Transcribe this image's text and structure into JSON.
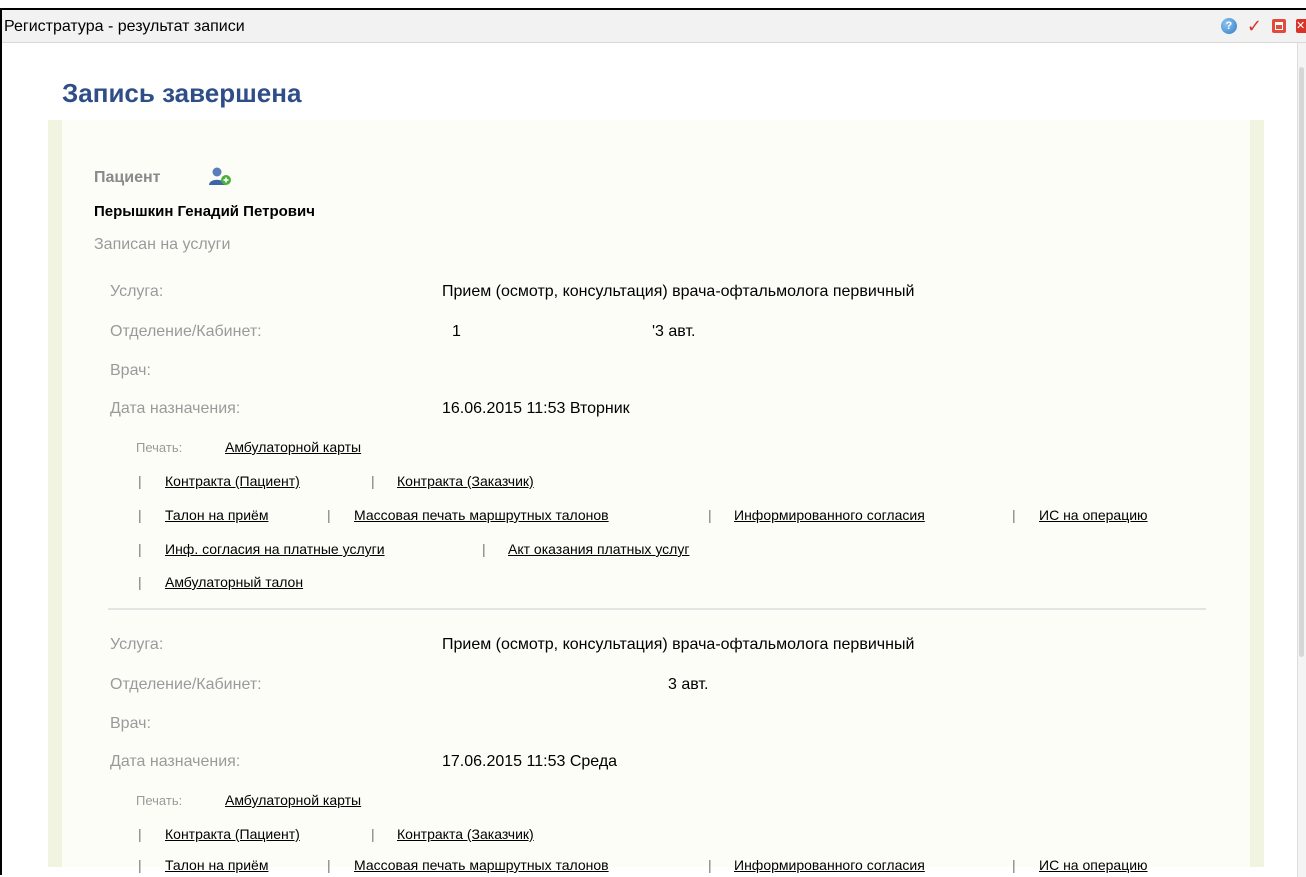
{
  "window": {
    "title": "Регистратура - результат записи",
    "help_glyph": "?",
    "check_glyph": "✓",
    "close_glyph": "✕",
    "icons": [
      "help-icon",
      "check-icon",
      "minimize-icon",
      "close-icon"
    ],
    "accent_color": "#2f4e88"
  },
  "page": {
    "heading": "Запись завершена"
  },
  "patient": {
    "label": "Пациент",
    "name": "Перышкин Генадий Петрович",
    "enrolled_label": "Записан на услуги"
  },
  "labels": {
    "service": "Услуга:",
    "department": "Отделение/Кабинет:",
    "doctor": "Врач:",
    "date": "Дата назначения:",
    "print": "Печать:",
    "separator": "|"
  },
  "appointments": [
    {
      "service": "Прием (осмотр, консультация) врача-офтальмолога первичный",
      "department_a": "1",
      "department_b": "'3 авт.",
      "doctor": "",
      "date": "16.06.2015 11:53 Вторник"
    },
    {
      "service": "Прием (осмотр, консультация) врача-офтальмолога первичный",
      "department_a": "",
      "department_b": "3 авт.",
      "doctor": "",
      "date": "17.06.2015 11:53 Среда"
    }
  ],
  "print_links": {
    "outpatient_card": "Амбулаторной карты",
    "contract_patient": "Контракта (Пациент)",
    "contract_customer": "Контракта (Заказчик)",
    "ticket": "Талон на приём",
    "mass_print": "Массовая печать маршрутных талонов",
    "informed_consent": "Информированного согласия",
    "surgery_consent": "ИС на операцию",
    "paid_consent": "Инф. согласия на платные услуги",
    "paid_act": "Акт оказания платных услуг",
    "outpatient_ticket": "Амбулаторный талон"
  }
}
